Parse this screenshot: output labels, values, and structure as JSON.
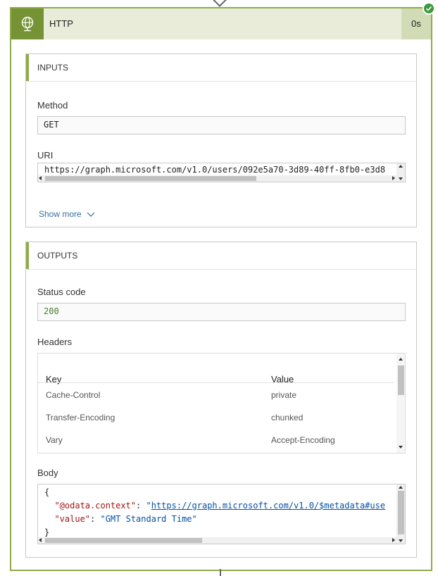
{
  "card": {
    "title": "HTTP",
    "duration": "0s",
    "status": "succeeded"
  },
  "inputs": {
    "section_title": "INPUTS",
    "method_label": "Method",
    "method_value": "GET",
    "uri_label": "URI",
    "uri_value": "https://graph.microsoft.com/v1.0/users/092e5a70-3d89-40ff-8fb0-e3d8",
    "show_more": "Show more"
  },
  "outputs": {
    "section_title": "OUTPUTS",
    "status_code_label": "Status code",
    "status_code_value": "200",
    "headers_label": "Headers",
    "headers_columns": {
      "key": "Key",
      "value": "Value"
    },
    "headers_rows": [
      {
        "key": "Cache-Control",
        "value": "private"
      },
      {
        "key": "Transfer-Encoding",
        "value": "chunked"
      },
      {
        "key": "Vary",
        "value": "Accept-Encoding"
      }
    ],
    "body_label": "Body",
    "body": {
      "open": "{",
      "line1_key": "\"@odata.context\"",
      "line1_sep": ": ",
      "line1_quote": "\"",
      "line1_url": "https://graph.microsoft.com/v1.0/$metadata#use",
      "line2_key": "\"value\"",
      "line2_sep": ": ",
      "line2_value": "\"GMT Standard Time\"",
      "close": "}"
    }
  },
  "icons": {
    "header": "globe-icon",
    "badge": "check-icon",
    "show_more": "chevron-down-icon"
  },
  "colors": {
    "accent": "#8fab48",
    "header_icon_bg": "#759334",
    "header_bg": "#e8ecd9",
    "duration_bg": "#d1dbb5",
    "success": "#3c9a3c",
    "link": "#3a6ea5"
  }
}
